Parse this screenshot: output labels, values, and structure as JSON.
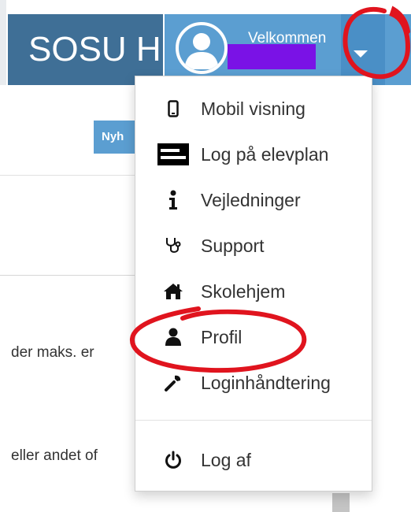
{
  "header": {
    "brand": "SOSU H",
    "welcome": "Velkommen"
  },
  "page": {
    "button_fragment": "Nyh",
    "text_line_1": "der maks. er",
    "text_line_2": "eller andet of"
  },
  "menu": {
    "items": [
      {
        "label": "Mobil visning",
        "icon": "mobile-icon"
      },
      {
        "label": "Log på elevplan",
        "icon": "elevplan-logo-icon"
      },
      {
        "label": "Vejledninger",
        "icon": "info-icon"
      },
      {
        "label": "Support",
        "icon": "stethoscope-icon"
      },
      {
        "label": "Skolehjem",
        "icon": "home-icon"
      },
      {
        "label": "Profil",
        "icon": "user-icon"
      },
      {
        "label": "Loginhåndtering",
        "icon": "wrench-icon"
      },
      {
        "label": "Log af",
        "icon": "power-icon"
      }
    ]
  },
  "colors": {
    "brand_bg": "#3f6f96",
    "user_bar_bg": "#5b9ed1",
    "redacted_name": "#7a12e6",
    "annotation_red": "#e0141e"
  }
}
